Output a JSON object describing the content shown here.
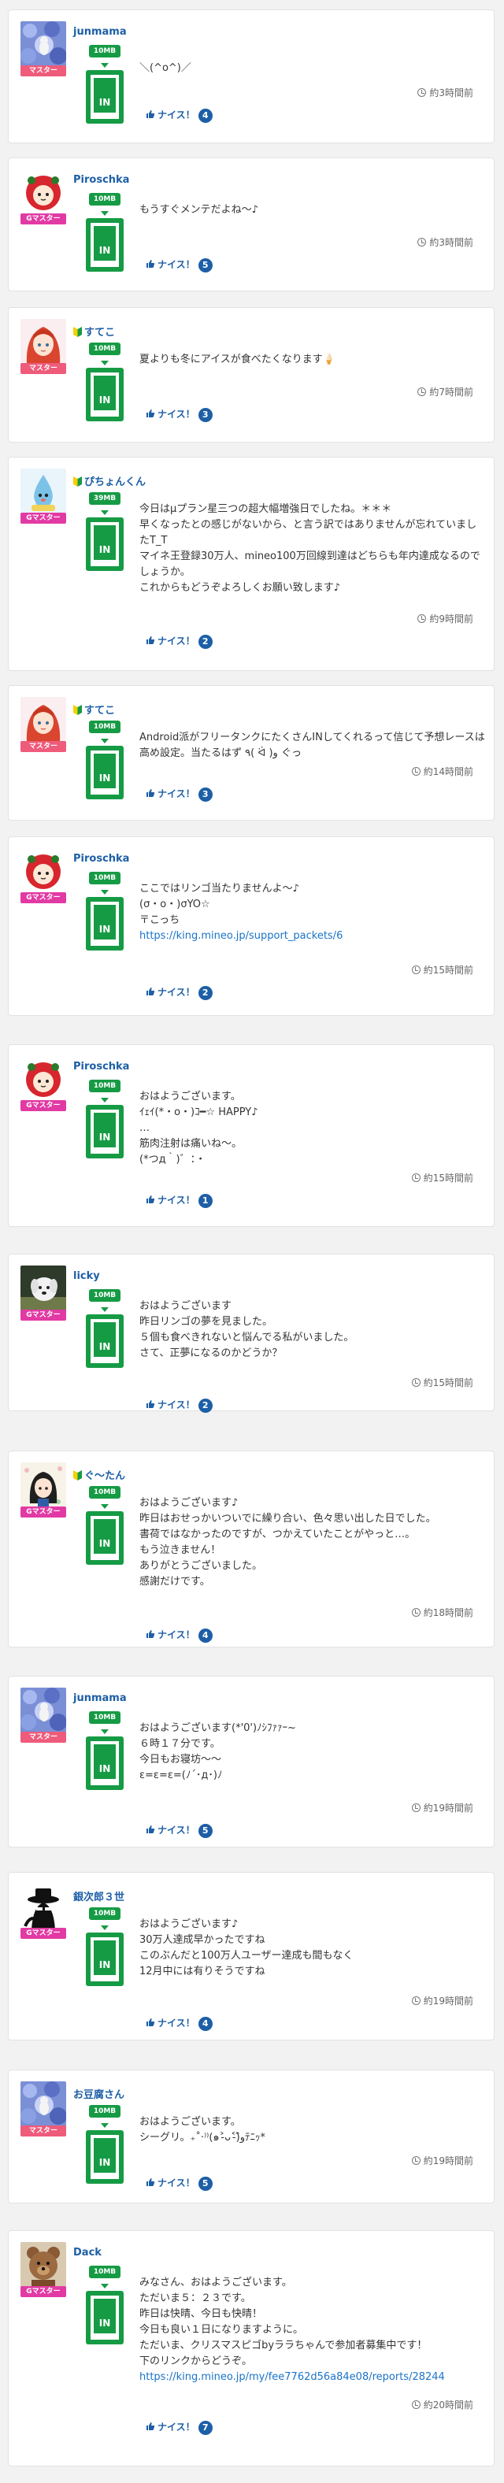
{
  "labels": {
    "nice": "ナイス！"
  },
  "colors": {
    "green": "#169b45",
    "pink_badge": "#ee5b7b",
    "magenta_badge": "#e23aa4",
    "link": "#1a73c9",
    "username": "#1d5fa6"
  },
  "posts": [
    {
      "user": "junmama",
      "badge": "マスター",
      "badge_color": "pink",
      "beginner": false,
      "mb": "10MB",
      "in_label": "IN",
      "message": "＼(^o^)／",
      "link": "",
      "time": "約3時間前",
      "nice": "4",
      "avatar": "hydrangea-avatar"
    },
    {
      "user": "Piroschka",
      "badge": "Gマスター",
      "badge_color": "magenta",
      "beginner": false,
      "mb": "10MB",
      "in_label": "IN",
      "message": "もうすぐメンテだよね〜♪",
      "link": "",
      "time": "約3時間前",
      "nice": "5",
      "avatar": "red-character-avatar"
    },
    {
      "user": "すてこ",
      "badge": "マスター",
      "badge_color": "pink",
      "beginner": true,
      "mb": "10MB",
      "in_label": "IN",
      "message": "夏よりも冬にアイスが食べたくなります🍦",
      "link": "",
      "time": "約7時間前",
      "nice": "3",
      "avatar": "redhead-girl-avatar"
    },
    {
      "user": "ぴちょんくん",
      "badge": "Gマスター",
      "badge_color": "magenta",
      "beginner": true,
      "mb": "39MB",
      "in_label": "IN",
      "message": "今日はμプラン星三つの超大幅増強日でしたね。＊＊＊\n早くなったとの感じがないから、と言う訳ではありませんが忘れていましたT_T\nマイネ王登録30万人、mineo100万回線到達はどちらも年内達成なるのでしょうか。\nこれからもどうぞよろしくお願い致します♪",
      "link": "",
      "time": "約9時間前",
      "nice": "2",
      "avatar": "blue-droplet-avatar"
    },
    {
      "user": "すてこ",
      "badge": "マスター",
      "badge_color": "pink",
      "beginner": true,
      "mb": "10MB",
      "in_label": "IN",
      "message": "Android派がフリータンクにたくさんINしてくれるって信じて予想レースは高め設定。当たるはず ٩( ᐛ )و ぐっ",
      "link": "",
      "time": "約14時間前",
      "nice": "3",
      "avatar": "redhead-girl-avatar"
    },
    {
      "user": "Piroschka",
      "badge": "Gマスター",
      "badge_color": "magenta",
      "beginner": false,
      "mb": "10MB",
      "in_label": "IN",
      "message": "ここではリンゴ当たりませんよ〜♪\n(σ・o・)σYO☆\n〒こっち",
      "link": "https://king.mineo.jp/support_packets/6",
      "time": "約15時間前",
      "nice": "2",
      "avatar": "red-character-avatar"
    },
    {
      "user": "Piroschka",
      "badge": "Gマスター",
      "badge_color": "magenta",
      "beginner": false,
      "mb": "10MB",
      "in_label": "IN",
      "message": "おはようございます。\nｲｪｲ(*・o・)ｺ━☆ HAPPY♪\n…\n筋肉注射は痛いね〜。\n(*つд｀)゛：・",
      "link": "",
      "time": "約15時間前",
      "nice": "1",
      "avatar": "red-character-avatar"
    },
    {
      "user": "licky",
      "badge": "Gマスター",
      "badge_color": "magenta",
      "beginner": false,
      "mb": "10MB",
      "in_label": "IN",
      "message": "おはようございます\n昨日リンゴの夢を見ました。\n５個も食べきれないと悩んでる私がいました。\nさて、正夢になるのかどうか？",
      "link": "",
      "time": "約15時間前",
      "nice": "2",
      "avatar": "white-dog-avatar"
    },
    {
      "user": "ぐ〜たん",
      "badge": "Gマスター",
      "badge_color": "magenta",
      "beginner": true,
      "mb": "10MB",
      "in_label": "IN",
      "message": "おはようございます♪\n昨日はおせっかいついでに繰り合い、色々思い出した日でした。\n書荷ではなかったのですが、つかえていたことがやっと…。\nもう泣きません！\nありがとうございました。\n感謝だけです。",
      "link": "",
      "time": "約18時間前",
      "nice": "4",
      "avatar": "dark-hair-girl-avatar"
    },
    {
      "user": "junmama",
      "badge": "マスター",
      "badge_color": "pink",
      "beginner": false,
      "mb": "10MB",
      "in_label": "IN",
      "message": "おはようございます(*'0')ﾉｼﾌｧｧｰ~\n６時１７分です。\n今日もお寝坊〜〜\nε=ε=ε=(ﾉ´･д･)ﾉ",
      "link": "",
      "time": "約19時間前",
      "nice": "5",
      "avatar": "hydrangea-avatar"
    },
    {
      "user": "銀次郎３世",
      "badge": "Gマスター",
      "badge_color": "magenta",
      "beginner": false,
      "mb": "10MB",
      "in_label": "IN",
      "message": "おはようございます♪\n30万人達成早かったですね\nこのぶんだと100万人ユーザー達成も間もなく\n12月中には有りそうですね",
      "link": "",
      "time": "約19時間前",
      "nice": "4",
      "avatar": "black-hat-avatar"
    },
    {
      "user": "お豆腐さん",
      "badge": "マスター",
      "badge_color": "pink",
      "beginner": false,
      "mb": "10MB",
      "in_label": "IN",
      "message": "おはようございます。\nシーグリ。₊˚‧⁾⁾(๑˃̵ᴗ˂̵)و̑̑ﾃﾆｯ*",
      "link": "",
      "time": "約19時間前",
      "nice": "5",
      "avatar": "hydrangea-avatar"
    },
    {
      "user": "Dack",
      "badge": "Gマスター",
      "badge_color": "magenta",
      "beginner": false,
      "mb": "10MB",
      "in_label": "IN",
      "message": "みなさん、おはようございます。\nただいま５：２３です。\n昨日は快晴、今日も快晴！\n今日も良い１日になりますように。\nただいま、クリスマスピゴbyララちゃんで参加者募集中です！\n下のリンクからどうぞ。",
      "link": "https://king.mineo.jp/my/fee7762d56a84e08/reports/28244",
      "time": "約20時間前",
      "nice": "7",
      "avatar": "teddy-bear-avatar"
    }
  ]
}
